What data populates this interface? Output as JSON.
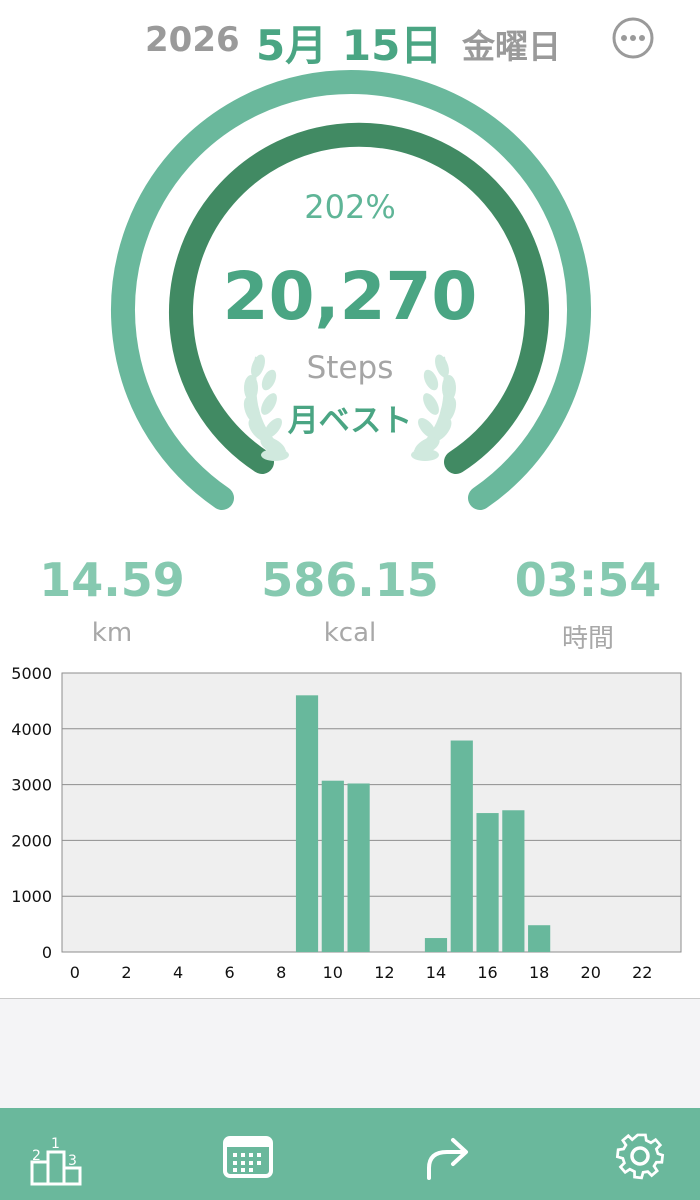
{
  "header": {
    "year": "2026",
    "date": "5月 15日",
    "weekday": "金曜日",
    "more_icon": "more-icon"
  },
  "goal": {
    "percent": "202%",
    "steps": "20,270",
    "unit": "Steps",
    "badge": "月ベスト",
    "badge_icon": "laurel-icon",
    "progress_fraction": 1.0
  },
  "stats": {
    "distance": {
      "value": "14.59",
      "unit": "km"
    },
    "calories": {
      "value": "586.15",
      "unit": "kcal"
    },
    "time": {
      "value": "03:54",
      "unit": "時間"
    }
  },
  "chart_data": {
    "type": "bar",
    "title": "",
    "xlabel": "",
    "ylabel": "",
    "x_ticks": [
      "0",
      "2",
      "4",
      "6",
      "8",
      "10",
      "12",
      "14",
      "16",
      "18",
      "20",
      "22"
    ],
    "y_ticks": [
      "0",
      "1000",
      "2000",
      "3000",
      "4000",
      "5000"
    ],
    "ylim": [
      0,
      5000
    ],
    "categories": [
      0,
      1,
      2,
      3,
      4,
      5,
      6,
      7,
      8,
      9,
      10,
      11,
      12,
      13,
      14,
      15,
      16,
      17,
      18,
      19,
      20,
      21,
      22,
      23
    ],
    "values": [
      0,
      0,
      0,
      0,
      0,
      0,
      0,
      0,
      0,
      4600,
      3070,
      3020,
      0,
      0,
      250,
      3790,
      2490,
      2540,
      480,
      0,
      0,
      0,
      0,
      0
    ],
    "grid": true,
    "color": "#68b89c"
  },
  "tabbar": {
    "ranking_icon": "ranking-podium-icon",
    "calendar_icon": "calendar-icon",
    "share_icon": "share-icon",
    "settings_icon": "gear-icon"
  },
  "colors": {
    "accent": "#4aa583",
    "outer_ring": "#6ab89c",
    "inner_ring": "#418a63",
    "tabbar": "#6ab89c"
  }
}
